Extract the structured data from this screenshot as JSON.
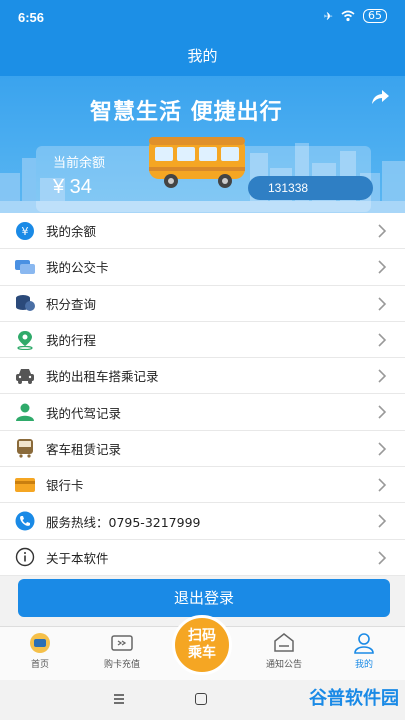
{
  "status_bar": {
    "time": "6:56",
    "battery": "65"
  },
  "header": {
    "title": "我的"
  },
  "banner": {
    "slogan": "智慧生活 便捷出行",
    "balance_label": "当前余额",
    "balance_amount": "¥ 34",
    "phone": "131338"
  },
  "menu": {
    "items": [
      {
        "label": "我的余额",
        "icon": "yen-coin-icon",
        "color": "#1a8ae6"
      },
      {
        "label": "我的公交卡",
        "icon": "bus-card-icon",
        "color": "#4a90e2"
      },
      {
        "label": "积分查询",
        "icon": "coin-stack-icon",
        "color": "#2b4a7a"
      },
      {
        "label": "我的行程",
        "icon": "map-pin-icon",
        "color": "#2faa6a"
      },
      {
        "label": "我的出租车搭乘记录",
        "icon": "taxi-icon",
        "color": "#555555"
      },
      {
        "label": "我的代驾记录",
        "icon": "driver-icon",
        "color": "#2faa6a"
      },
      {
        "label": "客车租赁记录",
        "icon": "coach-icon",
        "color": "#8a6a3a"
      },
      {
        "label": "银行卡",
        "icon": "bank-card-icon",
        "color": "#f5a623"
      },
      {
        "label": "服务热线：0795-3217999",
        "icon": "phone-icon",
        "color": "#1a8ae6"
      },
      {
        "label": "关于本软件",
        "icon": "info-icon",
        "color": "#333333"
      }
    ]
  },
  "logout": {
    "label": "退出登录"
  },
  "tabs": {
    "home": "首页",
    "buy": "购卡充值",
    "scan": "扫码乘车",
    "notice": "通知公告",
    "me": "我的"
  },
  "watermark": "谷普软件园",
  "colors": {
    "primary": "#1a8ae6",
    "accent": "#f5a623"
  }
}
